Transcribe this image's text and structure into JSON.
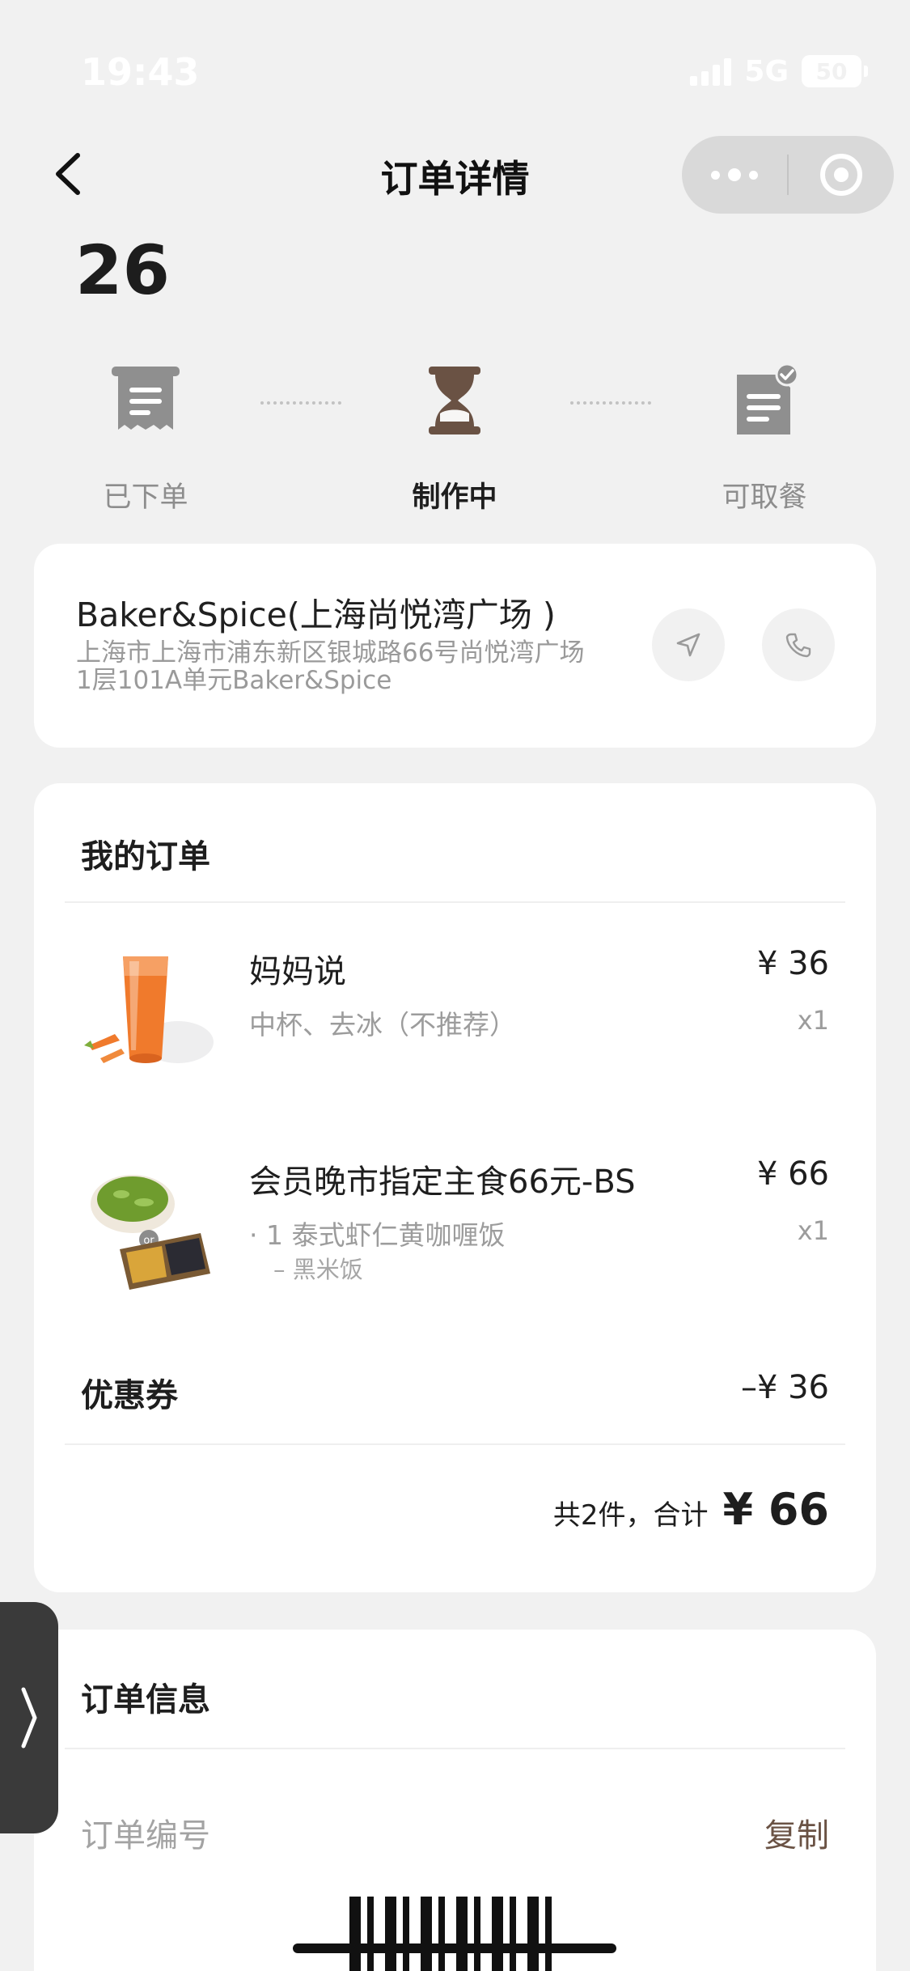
{
  "status_bar": {
    "time": "19:43",
    "network": "5G",
    "battery": "50"
  },
  "nav": {
    "title": "订单详情"
  },
  "order": {
    "number": "26"
  },
  "steps": [
    {
      "label": "已下单",
      "icon": "receipt-icon",
      "active": false
    },
    {
      "label": "制作中",
      "icon": "hourglass-icon",
      "active": true
    },
    {
      "label": "可取餐",
      "icon": "document-check-icon",
      "active": false
    }
  ],
  "store": {
    "name": "Baker&Spice(上海尚悦湾广场 )",
    "address_line1": "上海市上海市浦东新区银城路66号尚悦湾广场",
    "address_line2": "1层101A单元Baker&Spice"
  },
  "my_order": {
    "title": "我的订单",
    "items": [
      {
        "name": "妈妈说",
        "spec": "中杯、去冰（不推荐）",
        "price": "¥ 36",
        "qty": "x1"
      },
      {
        "name": "会员晚市指定主食66元-BS",
        "spec": "· 1 泰式虾仁黄咖喱饭",
        "sub": "– 黑米饭",
        "price": "¥ 66",
        "qty": "x1"
      }
    ],
    "coupon_label": "优惠券",
    "coupon_value": "–¥ 36",
    "summary_text": "共2件，合计",
    "total": "¥ 66"
  },
  "order_info": {
    "title": "订单信息",
    "order_no_label": "订单编号",
    "copy_label": "复制"
  },
  "colors": {
    "background": "#f1f1f1",
    "accent_brown": "#6a5244",
    "icon_gray": "#8f8f8f"
  }
}
